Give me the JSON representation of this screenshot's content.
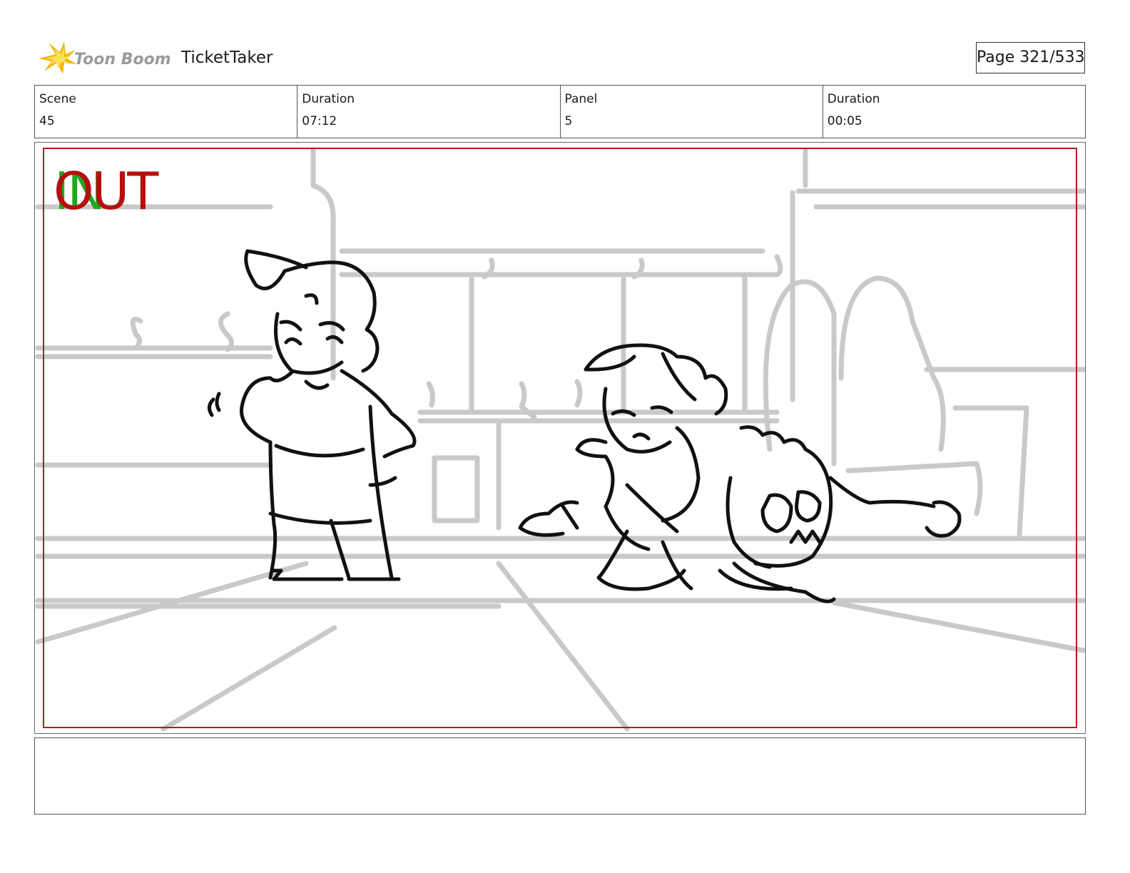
{
  "header": {
    "brand": "Toon Boom",
    "project": "TicketTaker",
    "page_label": "Page 321/533"
  },
  "info": [
    {
      "label": "Scene",
      "value": "45"
    },
    {
      "label": "Duration",
      "value": "07:12"
    },
    {
      "label": "Panel",
      "value": "5"
    },
    {
      "label": "Duration",
      "value": "00:05"
    }
  ],
  "panel": {
    "in_marker": "IN",
    "out_marker": "OUT",
    "colors": {
      "in_marker": "#1fa81f",
      "out_marker": "#b50f0f",
      "safe_frame": "#b01c1c"
    }
  },
  "notes": ""
}
